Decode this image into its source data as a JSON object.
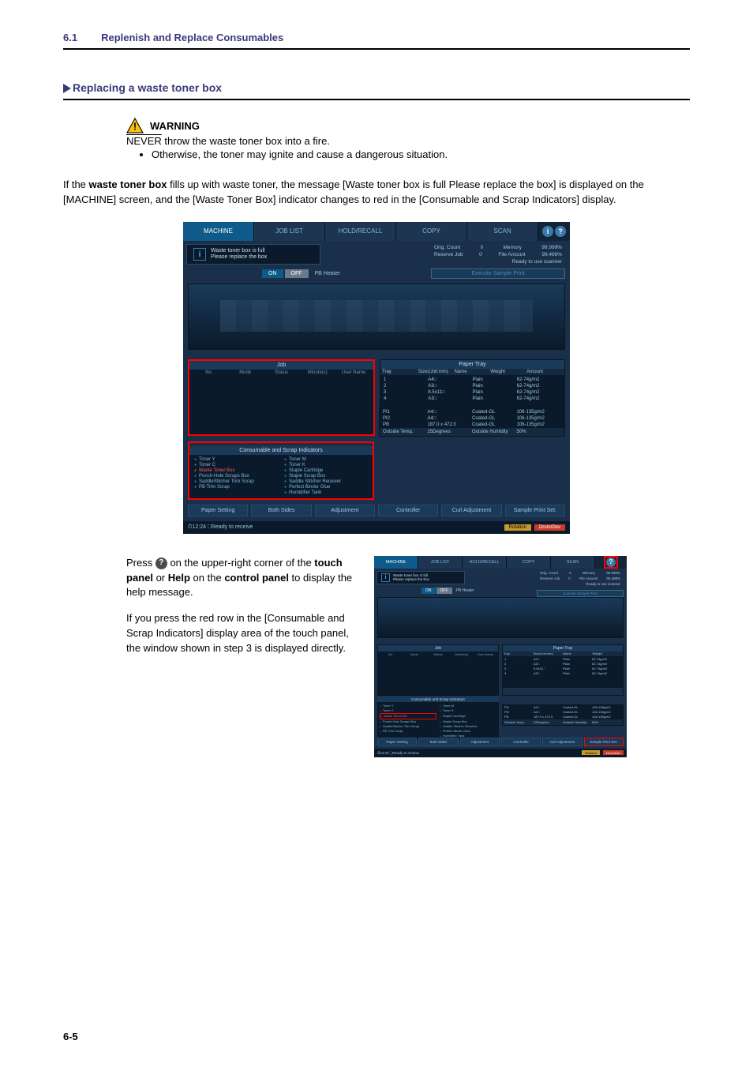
{
  "header": {
    "section_num": "6.1",
    "section_title": "Replenish and Replace Consumables"
  },
  "subheading": "Replacing a waste toner box",
  "warning": {
    "title": "WARNING",
    "line1_never": "NEVER",
    "line1_rest": " throw the waste toner box into a fire.",
    "bullet": "Otherwise, the toner may ignite and cause a dangerous situation."
  },
  "intro_prefix": "If the ",
  "intro_bold": "waste toner box",
  "intro_rest": " fills up with waste toner, the message [Waste toner box is full Please replace the box] is displayed on the [MACHINE] screen, and the [Waste Toner Box] indicator changes to red in the [Consumable and Scrap Indicators] display.",
  "main_shot": {
    "tabs": [
      "MACHINE",
      "JOB LIST",
      "HOLD/RECALL",
      "COPY",
      "SCAN"
    ],
    "alert_line1": "Waste toner box is full",
    "alert_line2": "Please replace the box",
    "heater_on": "ON",
    "heater_off": "OFF",
    "heater_label": "PB Heater",
    "orig_count_label": "Orig. Count",
    "orig_count_val": "0",
    "memory_label": "Memory",
    "memory_val": "99.999%",
    "reserve_job_label": "Reserve Job",
    "reserve_job_val": "0",
    "file_amount_label": "File Amount",
    "file_amount_val": "99.498%",
    "ready_scanner": "Ready to use scanner",
    "sample_print": "Execute Sample Print",
    "job_header": "Job",
    "job_cols": [
      "No.",
      "Mode",
      "Status",
      "Minute(s)",
      "User Name"
    ],
    "tray_header": "Paper Tray",
    "tray_cols": [
      "Tray",
      "Size(Unit:mm)",
      "Name",
      "Weight",
      "Amount"
    ],
    "trays": [
      {
        "n": "1",
        "size": "A4□",
        "name": "Plain",
        "weight": "62-74g/m2"
      },
      {
        "n": "2",
        "size": "A3□",
        "name": "Plain",
        "weight": "62-74g/m2"
      },
      {
        "n": "3",
        "size": "8.5x11□",
        "name": "Plain",
        "weight": "62-74g/m2"
      },
      {
        "n": "4",
        "size": "A3□",
        "name": "Plain",
        "weight": "62-74g/m2"
      }
    ],
    "pi_trays": [
      {
        "n": "PI1",
        "size": "A4□",
        "name": "Coated-GL",
        "weight": "106-135g/m2"
      },
      {
        "n": "PI2",
        "size": "A4□",
        "name": "Coated-GL",
        "weight": "106-135g/m2"
      },
      {
        "n": "PB",
        "size": "187.0 x 472.0",
        "name": "Coated-GL",
        "weight": "106-135g/m2"
      }
    ],
    "temp_label": "Outside Temp.",
    "temp_val": "25Degrees",
    "humid_label": "Outside Humidity",
    "humid_val": "50%",
    "indicators_header": "Consumable and Scrap Indicators",
    "indicators_left": [
      "Toner Y",
      "Toner C",
      "Waste Toner Box",
      "Punch-Hole Scraps Box",
      "SaddleStitcher Trim Scrap",
      "PB Trim Scrap"
    ],
    "indicators_right": [
      "Toner M",
      "Toner K",
      "Staple Cartridge",
      "Staple Scrap Box",
      "Saddle Stitcher Receiver",
      "Perfect Binder Glue",
      "Humidifier Tank"
    ],
    "bottom_buttons": [
      "Paper Setting",
      "Both Sides",
      "Adjustment",
      "Controller",
      "Curl Adjustment",
      "Sample Print Set."
    ],
    "status_time": "12:24",
    "status_msg": "Ready to receive",
    "status_rotation": "Rotation",
    "status_drum": "Drum/Dev"
  },
  "twocol": {
    "p1_a": "Press ",
    "p1_b": " on the upper-right corner of the ",
    "p1_bold1": "touch panel",
    "p1_c": " or ",
    "p1_bold2": "Help",
    "p1_d": " on the ",
    "p1_bold3": "control panel",
    "p1_e": " to display the help message.",
    "p2": "If you press the red row in the [Consumable and Scrap Indicators] display area of the touch panel, the window shown in step 3 is displayed directly."
  },
  "footer_page": "6-5"
}
